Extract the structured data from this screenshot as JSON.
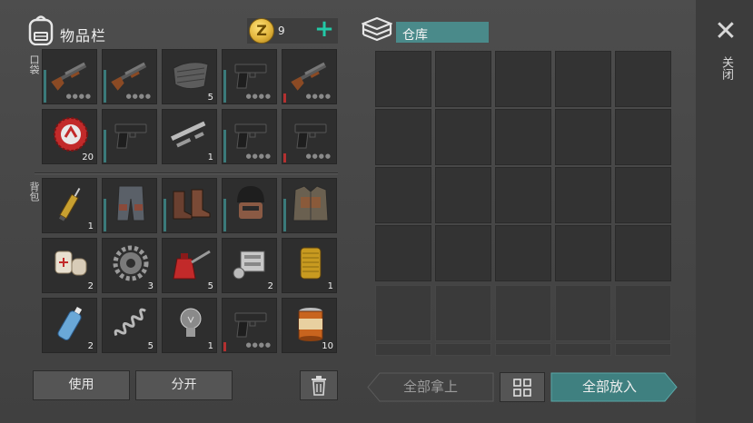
{
  "inventory": {
    "title": "物品栏",
    "coin_symbol": "Z",
    "coin_count": "9",
    "add_coins": "+",
    "pocket_label": "口袋",
    "backpack_label": "背包",
    "pocket_slots": [
      {
        "icon": "shotgun-icon",
        "qty": "",
        "bar": "#3a7a7a",
        "stars": "●●●●"
      },
      {
        "icon": "shotgun-icon",
        "qty": "",
        "bar": "#3a7a7a",
        "stars": "●●●●"
      },
      {
        "icon": "cloth-roll-icon",
        "qty": "5",
        "bar": "",
        "stars": ""
      },
      {
        "icon": "pistol-icon",
        "qty": "",
        "bar": "#3a7a7a",
        "stars": "●●●●"
      },
      {
        "icon": "shotgun-icon",
        "qty": "",
        "bar": "#b33030",
        "stars": "●●●●"
      },
      {
        "icon": "bottle-cap-icon",
        "qty": "20",
        "bar": "",
        "stars": ""
      },
      {
        "icon": "pistol-icon",
        "qty": "",
        "bar": "#3a7a7a",
        "stars": ""
      },
      {
        "icon": "pipe-parts-icon",
        "qty": "1",
        "bar": "",
        "stars": ""
      },
      {
        "icon": "pistol-icon",
        "qty": "",
        "bar": "#3a7a7a",
        "stars": "●●●●"
      },
      {
        "icon": "pistol-icon",
        "qty": "",
        "bar": "#b33030",
        "stars": "●●●●"
      }
    ],
    "backpack_slots": [
      {
        "icon": "syringe-icon",
        "qty": "1",
        "bar": "",
        "stars": ""
      },
      {
        "icon": "armored-pants-icon",
        "qty": "",
        "bar": "#3a7a7a",
        "stars": ""
      },
      {
        "icon": "boots-icon",
        "qty": "",
        "bar": "#3a7a7a",
        "stars": ""
      },
      {
        "icon": "helmet-icon",
        "qty": "",
        "bar": "#3a7a7a",
        "stars": ""
      },
      {
        "icon": "armor-vest-icon",
        "qty": "",
        "bar": "#3a7a7a",
        "stars": ""
      },
      {
        "icon": "bandage-icon",
        "qty": "2",
        "bar": "",
        "stars": ""
      },
      {
        "icon": "gear-icon",
        "qty": "3",
        "bar": "",
        "stars": ""
      },
      {
        "icon": "oil-can-icon",
        "qty": "5",
        "bar": "",
        "stars": ""
      },
      {
        "icon": "engine-part-icon",
        "qty": "2",
        "bar": "",
        "stars": ""
      },
      {
        "icon": "filter-icon",
        "qty": "1",
        "bar": "",
        "stars": ""
      },
      {
        "icon": "water-bottle-icon",
        "qty": "2",
        "bar": "",
        "stars": ""
      },
      {
        "icon": "spring-icon",
        "qty": "5",
        "bar": "",
        "stars": ""
      },
      {
        "icon": "light-bulb-icon",
        "qty": "1",
        "bar": "",
        "stars": ""
      },
      {
        "icon": "pistol-icon",
        "qty": "",
        "bar": "#b33030",
        "stars": "●●●●"
      },
      {
        "icon": "canned-food-icon",
        "qty": "10",
        "bar": "",
        "stars": ""
      }
    ],
    "use_button": "使用",
    "split_button": "分开",
    "trash_icon": "trash-icon"
  },
  "warehouse": {
    "title": "仓库",
    "icon": "stacked-boxes-icon",
    "take_all_button": "全部拿上",
    "grid_button_icon": "grid-icon",
    "put_all_button": "全部放入"
  },
  "close": {
    "label": "关闭",
    "icon": "close-icon"
  },
  "colors": {
    "accent_teal": "#4a8a8a",
    "durability_teal": "#3a7a7a",
    "durability_red": "#b33030",
    "coin_gold": "#e2b53c",
    "plus_green": "#22c9a6"
  }
}
